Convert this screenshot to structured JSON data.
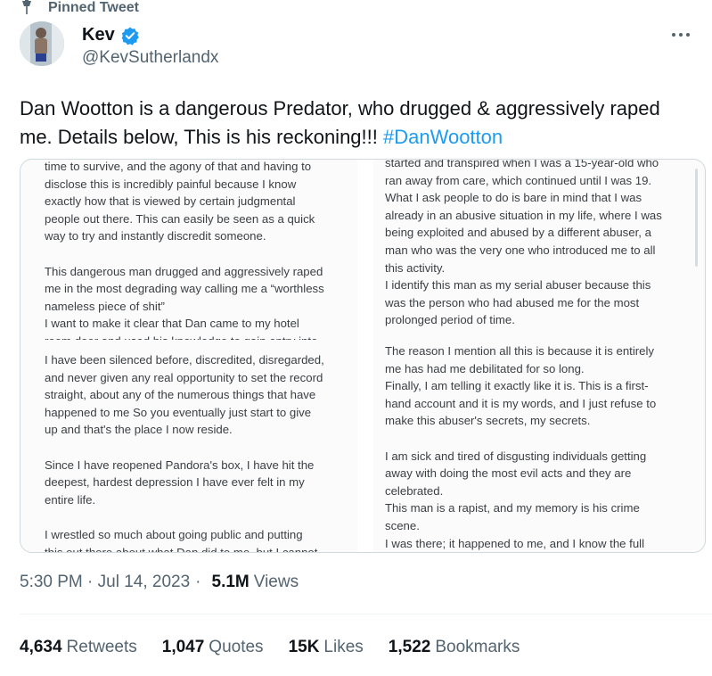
{
  "pinned": {
    "label": "Pinned Tweet"
  },
  "author": {
    "name": "Kev",
    "handle": "@KevSutherlandx"
  },
  "tweet": {
    "text": "Dan Wootton is a dangerous Predator, who drugged & aggressively raped me. Details below, This is his reckoning!!! ",
    "hashtag": "#DanWootton"
  },
  "media": {
    "left_top": [
      "time to survive, and the agony of that and having to",
      "disclose this is incredibly painful because I know",
      "exactly how that is viewed by certain judgmental",
      "people out there. This can easily be seen as a quick",
      "way to try and instantly discredit someone.",
      "",
      "This dangerous man drugged and aggressively raped",
      "me in the most degrading way calling me a “worthless",
      "nameless piece of shit”",
      "I want to make it clear that Dan came to my hotel",
      "room door and used his knowledge to gain entry into"
    ],
    "left_bottom": [
      "I have been silenced before, discredited, disregarded,",
      "and never given any real opportunity to set the record",
      "straight, about any of the numerous things that have",
      "happened to me So you eventually just start to give",
      "up and that's the place I now reside.",
      "",
      "Since I have reopened Pandora's box, I have hit the",
      "deepest, hardest depression I have ever felt in my",
      "entire life.",
      "",
      "I wrestled so much about going public and putting",
      "this out there about what Dan did to me, but I cannot"
    ],
    "right_top": [
      "started and transpired when I was a 15-year-old who",
      "ran away from care, which continued until I was 19.",
      "What I ask people to do is bare in mind that I was",
      "already in an abusive situation in my life, where I was",
      "being exploited and abused by a different abuser, a",
      "man who was the very one who introduced me to all",
      "this activity.",
      "I identify this man as my serial abuser because this",
      "was the person who had abused me for the most",
      "prolonged period of time."
    ],
    "right_bottom": [
      "The reason I mention all this is because it is entirely",
      "me has had me debilitated for so long.",
      "Finally, I am telling it exactly like it is. This is a first-",
      "hand account and it is my words, and I just refuse to",
      "make this abuser's secrets, my secrets.",
      "",
      "I am sick and tired of disgusting individuals getting",
      "away with doing the most evil acts and they are",
      "celebrated.",
      "This man is a rapist, and my memory is his crime",
      "scene.",
      "I was there; it happened to me, and I know the full"
    ]
  },
  "meta": {
    "time": "5:30 PM · Jul 14, 2023",
    "views_count": "5.1M",
    "views_label": "Views"
  },
  "stats": [
    {
      "count": "4,634",
      "label": "Retweets"
    },
    {
      "count": "1,047",
      "label": "Quotes"
    },
    {
      "count": "15K",
      "label": "Likes"
    },
    {
      "count": "1,522",
      "label": "Bookmarks"
    }
  ],
  "colors": {
    "accent": "#1d9bf0",
    "secondary_text": "#536471",
    "primary_text": "#0f1419"
  },
  "icons": [
    "pin-icon",
    "verified-badge-icon",
    "more-options-icon"
  ]
}
